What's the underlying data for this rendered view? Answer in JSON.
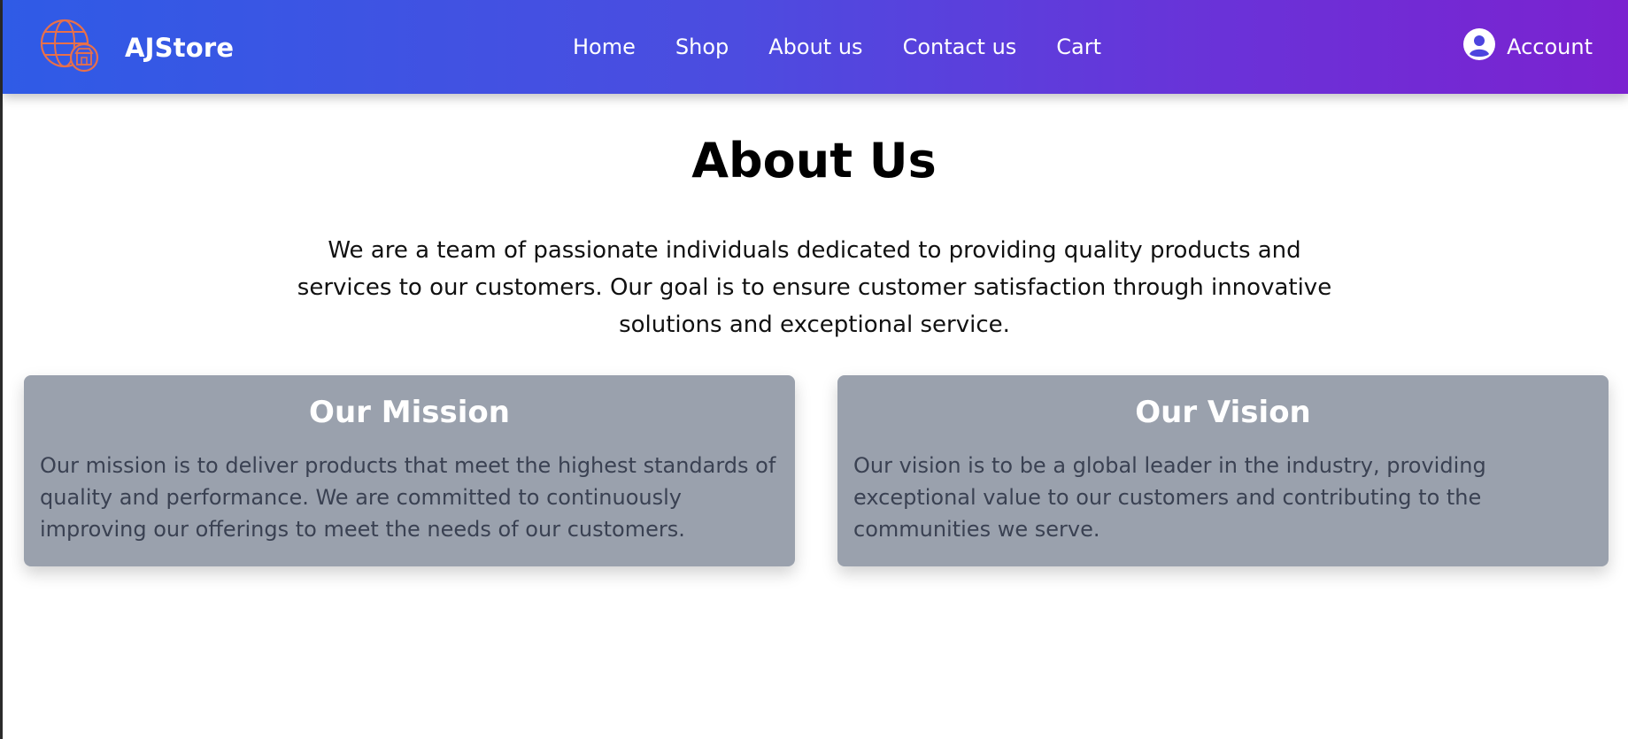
{
  "brand": {
    "name": "AJStore",
    "logo_icon": "globe-store-icon"
  },
  "nav": {
    "links": [
      {
        "label": "Home"
      },
      {
        "label": "Shop"
      },
      {
        "label": "About us"
      },
      {
        "label": "Contact us"
      },
      {
        "label": "Cart"
      }
    ],
    "account_label": "Account",
    "account_icon": "user-circle-icon",
    "gradient_colors": [
      "#2f5be6",
      "#7b22d0"
    ]
  },
  "main": {
    "title": "About Us",
    "intro": "We are a team of passionate individuals dedicated to providing quality products and services to our customers. Our goal is to ensure customer satisfaction through innovative solutions and exceptional service.",
    "cards": [
      {
        "title": "Our Mission",
        "text": "Our mission is to deliver products that meet the highest standards of quality and performance. We are committed to continuously improving our offerings to meet the needs of our customers."
      },
      {
        "title": "Our Vision",
        "text": "Our vision is to be a global leader in the industry, providing exceptional value to our customers and contributing to the communities we serve."
      }
    ],
    "card_color": "#9aa1ad"
  }
}
